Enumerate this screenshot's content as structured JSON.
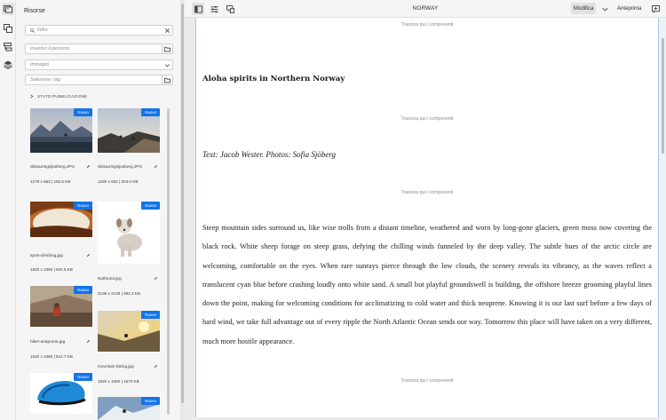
{
  "rail": {
    "icons": [
      "assets-icon",
      "components-icon",
      "content-tree-icon",
      "layers-icon"
    ]
  },
  "panel": {
    "title": "Risorse",
    "filter_placeholder": "Filtro",
    "path_placeholder": "Inserisci il percorso",
    "type_value": "Immagini",
    "tags_placeholder": "Seleziona i tag",
    "publication_status": "STATO PUBBLICAZIONE",
    "badge_label": "Nuovo",
    "assets": [
      {
        "name": "SkitouringSjoeberg.JPG",
        "meta": "1279 x 853 | 192.6 KB"
      },
      {
        "name": "SkitouringSjoeberg.JPG",
        "meta": "1280 x 853 | 203.0 KB"
      },
      {
        "name": "sport-climbing.jpg",
        "meta": "1920 x 1080 | 604.5 KB"
      },
      {
        "name": "Notfound.jpg",
        "meta": "2136 x 2135 | 392.3 KB"
      },
      {
        "name": "hiker-anapurna.jpg",
        "meta": "1620 x 1080 | 514.7 KB"
      },
      {
        "name": "mountain-biking.jpg",
        "meta": "1620 x 1080 | 1970 KB"
      },
      {
        "name": "",
        "meta": ""
      },
      {
        "name": "",
        "meta": ""
      }
    ]
  },
  "topbar": {
    "page_title": "NORWAY",
    "edit_mode": "Modifica",
    "preview_mode": "Anteprima"
  },
  "canvas": {
    "dropzone_label": "Trascina qui i componenti",
    "headline": "Aloha spirits in Northern Norway",
    "byline": "Text: Jacob Wester. Photos: Sofia Sjöberg",
    "body": "Steep mountain sides surround us, like wise trolls from a distant timeline, weathered and worn by long-gone glaciers, green moss now covering the black rock. White sheep forage on steep grass, defying the chilling winds funneled by the deep valley. The subtle hues of the arctic circle are welcoming, comfortable on the eyes. When rare sunrays pierce through the low clouds, the scenery reveals its vibrancy, as the waves reflect a translucent cyan blue before crashing loudly onto white sand. A small but playful groundswell is building, the offshore breeze grooming playful lines down the point, making for welcoming conditions for acclimatizing to cold water and thick neoprene. Knowing it is our last surf before a few days of hard wind, we take full advantage out of every ripple the North Atlantic Ocean sends our way. Tomorrow this place will have taken on a very different, much more hostile appearance."
  },
  "colors": {
    "accent": "#1473e6",
    "guide": "#a7c8ef"
  }
}
